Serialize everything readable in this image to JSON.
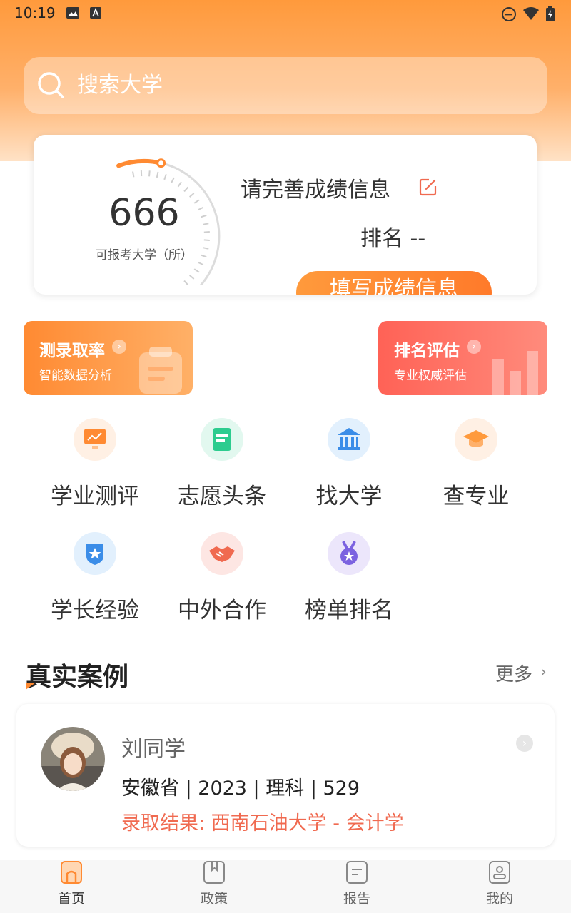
{
  "status_bar": {
    "time": "10:19"
  },
  "search": {
    "placeholder": "搜索大学"
  },
  "score_card": {
    "score": "666",
    "score_label": "可报考大学（所）",
    "title": "请完善成绩信息",
    "rank": "排名 --",
    "fill_button": "填写成绩信息",
    "gauge_fraction": 0.15
  },
  "promos": [
    {
      "title": "测录取率",
      "subtitle": "智能数据分析"
    },
    {
      "title": "排名评估",
      "subtitle": "专业权威评估"
    }
  ],
  "grid": [
    {
      "label": "学业测评",
      "icon": "chart-board-icon"
    },
    {
      "label": "志愿头条",
      "icon": "document-icon"
    },
    {
      "label": "找大学",
      "icon": "university-icon"
    },
    {
      "label": "查专业",
      "icon": "graduation-cap-icon"
    },
    {
      "label": "学长经验",
      "icon": "star-shield-icon"
    },
    {
      "label": "中外合作",
      "icon": "handshake-icon"
    },
    {
      "label": "榜单排名",
      "icon": "medal-icon"
    }
  ],
  "section": {
    "title": "真实案例",
    "more": "更多"
  },
  "case": {
    "name": "刘同学",
    "info": "安徽省 | 2023 | 理科 | 529",
    "result": "录取结果: 西南石油大学 - 会计学"
  },
  "nav": [
    {
      "label": "首页",
      "icon": "home-icon",
      "active": true
    },
    {
      "label": "政策",
      "icon": "book-icon",
      "active": false
    },
    {
      "label": "报告",
      "icon": "report-icon",
      "active": false
    },
    {
      "label": "我的",
      "icon": "profile-icon",
      "active": false
    }
  ],
  "colors": {
    "brand": "#ff8a32",
    "accent_red": "#f06a50"
  }
}
